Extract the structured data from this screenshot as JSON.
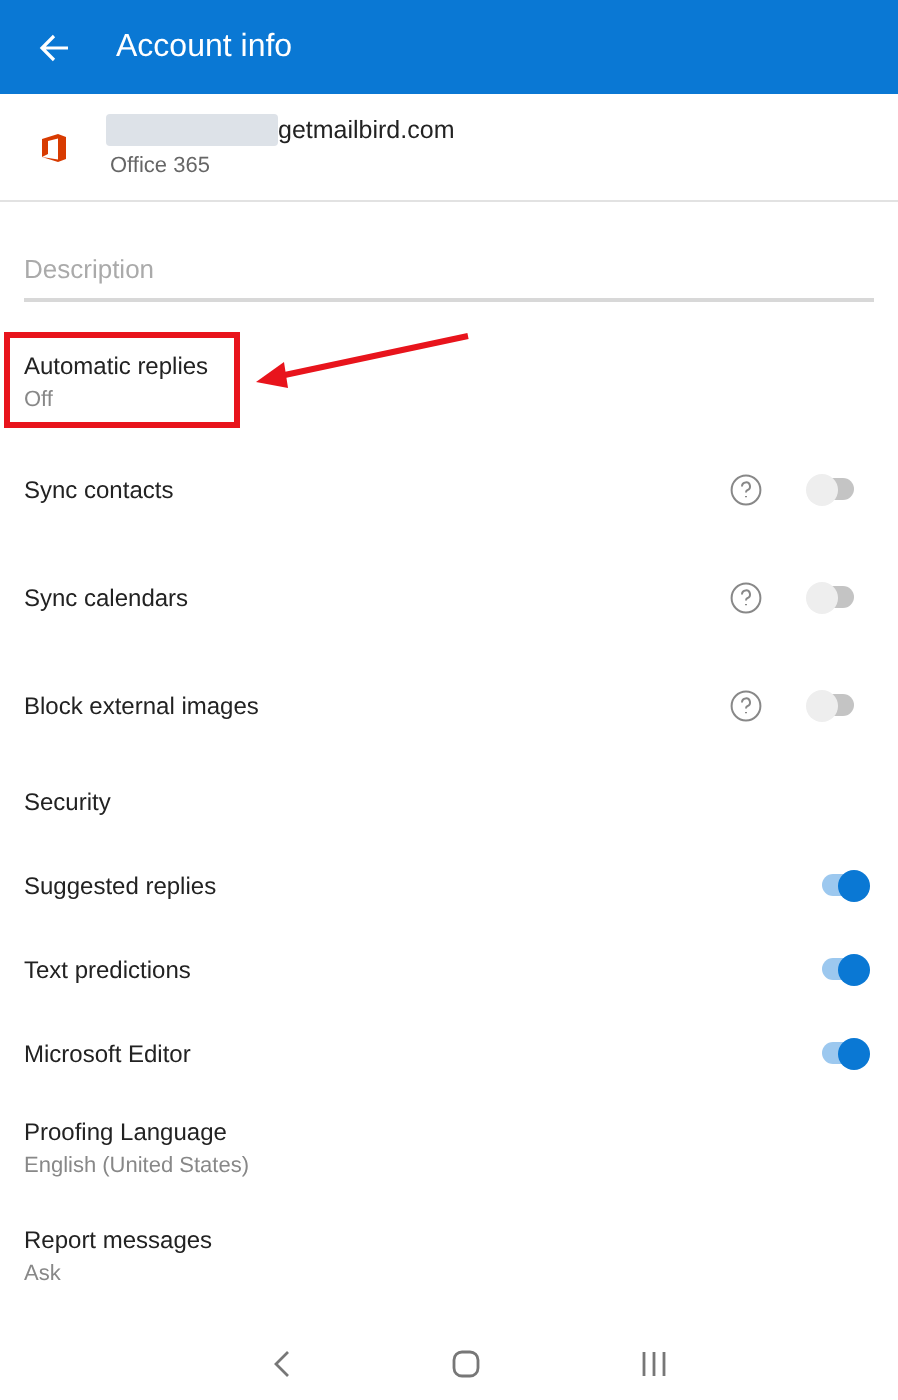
{
  "header": {
    "title": "Account info"
  },
  "account": {
    "email": "getmailbird.com",
    "type": "Office 365"
  },
  "description": {
    "placeholder": "Description"
  },
  "settings": [
    {
      "kind": "highlighted",
      "label": "Automatic replies",
      "value": "Off"
    },
    {
      "kind": "help_toggle",
      "label": "Sync contacts",
      "on": false
    },
    {
      "kind": "help_toggle",
      "label": "Sync calendars",
      "on": false
    },
    {
      "kind": "help_toggle",
      "label": "Block external images",
      "on": false
    },
    {
      "kind": "plain",
      "label": "Security"
    },
    {
      "kind": "toggle",
      "label": "Suggested replies",
      "on": true
    },
    {
      "kind": "toggle",
      "label": "Text predictions",
      "on": true
    },
    {
      "kind": "toggle",
      "label": "Microsoft Editor",
      "on": true
    },
    {
      "kind": "subtitle",
      "label": "Proofing Language",
      "value": "English (United States)"
    },
    {
      "kind": "subtitle",
      "label": "Report messages",
      "value": "Ask"
    }
  ]
}
